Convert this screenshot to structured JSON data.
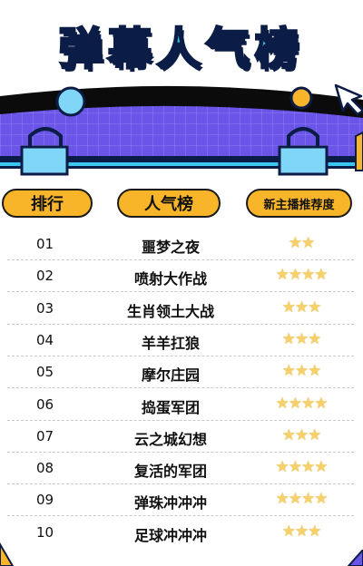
{
  "title": "弹幕人气榜",
  "headers": {
    "rank": "排行",
    "popularity": "人气榜",
    "recommend": "新主播推荐度"
  },
  "rows": [
    {
      "rank": "01",
      "name": "噩梦之夜",
      "stars": 2
    },
    {
      "rank": "02",
      "name": "喷射大作战",
      "stars": 4
    },
    {
      "rank": "03",
      "name": "生肖领土大战",
      "stars": 3
    },
    {
      "rank": "04",
      "name": "羊羊扛狼",
      "stars": 3
    },
    {
      "rank": "05",
      "name": "摩尔庄园",
      "stars": 3
    },
    {
      "rank": "06",
      "name": "捣蛋军团",
      "stars": 4
    },
    {
      "rank": "07",
      "name": "云之城幻想",
      "stars": 3
    },
    {
      "rank": "08",
      "name": "复活的军团",
      "stars": 4
    },
    {
      "rank": "09",
      "name": "弹珠冲冲冲",
      "stars": 4
    },
    {
      "rank": "10",
      "name": "足球冲冲冲",
      "stars": 3
    }
  ],
  "colors": {
    "accent": "#f9b52a",
    "title": "#3cc6f2",
    "band": "#6a55e8",
    "dark": "#0b1d46"
  }
}
